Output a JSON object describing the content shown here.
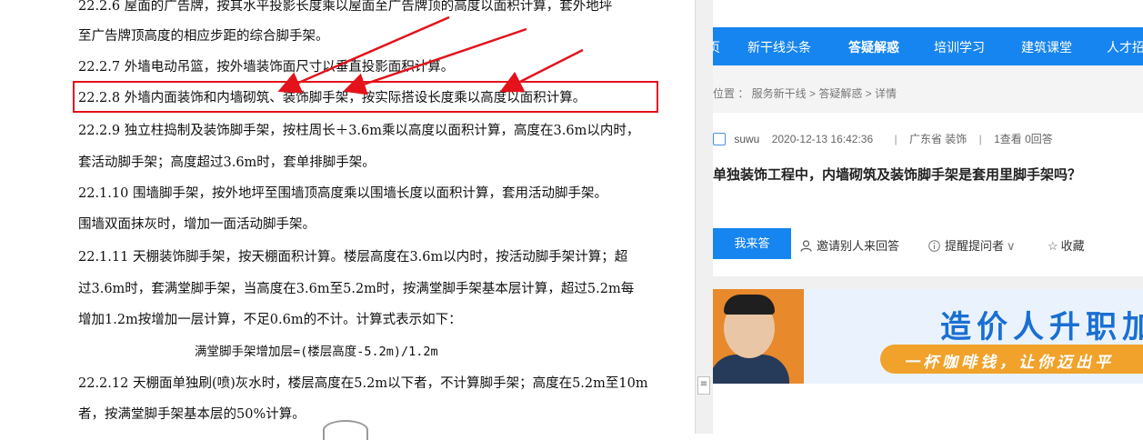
{
  "document": {
    "lines": [
      "22.2.6  屋面的广告牌，按其水平投影长度乘以屋面至广告牌顶的高度以面积计算，套外地坪",
      "至广告牌顶高度的相应步距的综合脚手架。",
      "22.2.7  外墙电动吊篮，按外墙装饰面尺寸以垂直投影面积计算。",
      "22.2.8  外墙内面装饰和内墙砌筑、装饰脚手架，按实际搭设长度乘以高度以面积计算。",
      "22.2.9  独立柱捣制及装饰脚手架，按柱周长＋3.6m乘以高度以面积计算，高度在3.6m以内时，",
      "套活动脚手架；高度超过3.6m时，套单排脚手架。",
      "22.1.10   围墙脚手架，按外地坪至围墙顶高度乘以围墙长度以面积计算，套用活动脚手架。",
      "围墙双面抹灰时，增加一面活动脚手架。",
      "22.1.11  天棚装饰脚手架，按天棚面积计算。楼层高度在3.6m以内时，按活动脚手架计算；超",
      "过3.6m时，套满堂脚手架，当高度在3.6m至5.2m时，按满堂脚手架基本层计算，超过5.2m每",
      "增加1.2m按增加一层计算，不足0.6m的不计。计算式表示如下：",
      "满堂脚手架增加层=(楼层高度-5.2m)/1.2m",
      "22.2.12  天棚面单独刷(喷)灰水时，楼层高度在5.2m以下者，不计算脚手架；高度在5.2m至10m",
      "者，按满堂脚手架基本层的50%计算。"
    ],
    "highlight_color": "#e3121b"
  },
  "scrollbar": {
    "grip_symbol": "≡"
  },
  "web": {
    "nav": {
      "items": [
        "页",
        "新干线头条",
        "答疑解惑",
        "培训学习",
        "建筑课堂",
        "人才招"
      ],
      "active": "答疑解惑",
      "color": "#1785ef"
    },
    "breadcrumb": "位置 ： 服务新干线 > 答疑解惑 > 详情",
    "meta": {
      "user": "suwu",
      "date": "2020-12-13 16:42:36",
      "sep1": "|",
      "region": "广东省  装饰",
      "sep2": "|",
      "stats": "1查看  0回答"
    },
    "question_title": "单独装饰工程中，内墙砌筑及装饰脚手架是套用里脚手架吗？",
    "actions": {
      "answer_button": "我来答",
      "invite": "邀请别人来回答",
      "remind": "提醒提问者",
      "collect": "收藏"
    },
    "banner": {
      "headline": "造价人升职加",
      "tagline": "一杯咖啡钱，让你迈出平"
    }
  }
}
